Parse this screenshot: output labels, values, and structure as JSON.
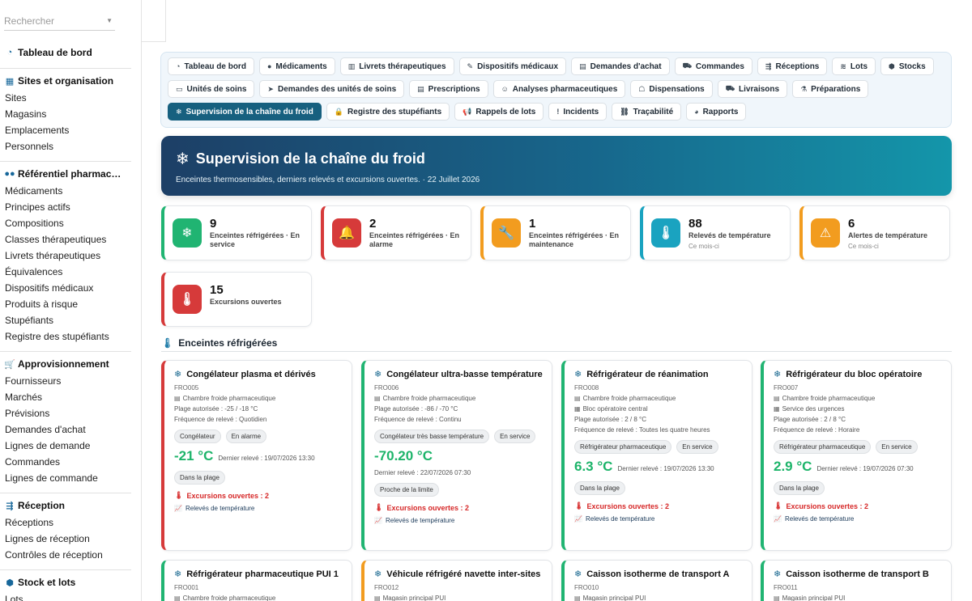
{
  "search": {
    "placeholder": "Rechercher"
  },
  "sidebar": {
    "dashboard": "Tableau de bord",
    "sections": [
      {
        "title": "Sites et organisation",
        "icon": "building-icon",
        "glyph": "▦",
        "items": [
          "Sites",
          "Magasins",
          "Emplacements",
          "Personnels"
        ]
      },
      {
        "title": "Référentiel pharmac…",
        "icon": "pills-icon",
        "glyph": "●●",
        "items": [
          "Médicaments",
          "Principes actifs",
          "Compositions",
          "Classes thérapeutiques",
          "Livrets thérapeutiques",
          "Équivalences",
          "Dispositifs médicaux",
          "Produits à risque",
          "Stupéfiants",
          "Registre des stupéfiants"
        ]
      },
      {
        "title": "Approvisionnement",
        "icon": "cart-icon",
        "glyph": "🛒",
        "items": [
          "Fournisseurs",
          "Marchés",
          "Prévisions",
          "Demandes d'achat",
          "Lignes de demande",
          "Commandes",
          "Lignes de commande"
        ]
      },
      {
        "title": "Réception",
        "icon": "truck-loading-icon",
        "glyph": "⇶",
        "items": [
          "Réceptions",
          "Lignes de réception",
          "Contrôles de réception"
        ]
      },
      {
        "title": "Stock et lots",
        "icon": "cubes-icon",
        "glyph": "⬢",
        "items": [
          "Lots"
        ]
      }
    ]
  },
  "tabs": {
    "row1": [
      {
        "label": "Tableau de bord",
        "icon": "gauge-icon",
        "glyph": "◔"
      },
      {
        "label": "Médicaments",
        "icon": "pills-icon",
        "glyph": "●"
      },
      {
        "label": "Livrets thérapeutiques",
        "icon": "book-icon",
        "glyph": "▥"
      },
      {
        "label": "Dispositifs médicaux",
        "icon": "syringe-icon",
        "glyph": "✎"
      },
      {
        "label": "Demandes d'achat",
        "icon": "file-icon",
        "glyph": "▤"
      },
      {
        "label": "Commandes",
        "icon": "cart-icon",
        "glyph": "⛟"
      },
      {
        "label": "Réceptions",
        "icon": "truck-loading-icon",
        "glyph": "⇶"
      },
      {
        "label": "Lots",
        "icon": "layers-icon",
        "glyph": "≋"
      },
      {
        "label": "Stocks",
        "icon": "cubes-icon",
        "glyph": "⬢"
      }
    ],
    "row2": [
      {
        "label": "Unités de soins",
        "icon": "bed-icon",
        "glyph": "▭"
      },
      {
        "label": "Demandes des unités de soins",
        "icon": "paper-plane-icon",
        "glyph": "➤"
      },
      {
        "label": "Prescriptions",
        "icon": "prescription-icon",
        "glyph": "▤"
      },
      {
        "label": "Analyses pharmaceutiques",
        "icon": "user-doctor-icon",
        "glyph": "☺"
      },
      {
        "label": "Dispensations",
        "icon": "hand-holding-medical-icon",
        "glyph": "☖"
      },
      {
        "label": "Livraisons",
        "icon": "truck-icon",
        "glyph": "⛟"
      },
      {
        "label": "Préparations",
        "icon": "mortar-pestle-icon",
        "glyph": "⚗"
      }
    ],
    "row3": [
      {
        "label": "Supervision de la chaîne du froid",
        "icon": "snowflake-icon",
        "glyph": "❄",
        "active": true
      },
      {
        "label": "Registre des stupéfiants",
        "icon": "lock-icon",
        "glyph": "🔒"
      },
      {
        "label": "Rappels de lots",
        "icon": "bullhorn-icon",
        "glyph": "📢"
      },
      {
        "label": "Incidents",
        "icon": "exclamation-circle-icon",
        "glyph": "!"
      },
      {
        "label": "Traçabilité",
        "icon": "sitemap-icon",
        "glyph": "⛓"
      },
      {
        "label": "Rapports",
        "icon": "chart-pie-icon",
        "glyph": "◕"
      }
    ]
  },
  "hero": {
    "title": "Supervision de la chaîne du froid",
    "subtitle": "Enceintes thermosensibles, derniers relevés et excursions ouvertes. · 22 Juillet 2026"
  },
  "stats": [
    {
      "value": "9",
      "label": "Enceintes réfrigérées · En service",
      "sub": "",
      "color": "#20b472",
      "icon": "snowflake-icon",
      "glyph": "❄"
    },
    {
      "value": "2",
      "label": "Enceintes réfrigérées · En alarme",
      "sub": "",
      "color": "#d63a3a",
      "icon": "bell-icon",
      "glyph": "🔔"
    },
    {
      "value": "1",
      "label": "Enceintes réfrigérées · En maintenance",
      "sub": "",
      "color": "#f29c1f",
      "icon": "wrench-icon",
      "glyph": "🔧"
    },
    {
      "value": "88",
      "label": "Relevés de température",
      "sub": "Ce mois-ci",
      "color": "#1aa3c0",
      "icon": "thermometer-icon",
      "glyph": "🌡"
    },
    {
      "value": "6",
      "label": "Alertes de température",
      "sub": "Ce mois-ci",
      "color": "#f29c1f",
      "icon": "warning-icon",
      "glyph": "⚠"
    },
    {
      "value": "15",
      "label": "Excursions ouvertes",
      "sub": "",
      "color": "#d63a3a",
      "icon": "thermometer-hot-icon",
      "glyph": "🌡"
    }
  ],
  "section_heading": "Enceintes réfrigérées",
  "cards": [
    {
      "title": "Congélateur plasma et dérivés",
      "code": "FRO005",
      "location": "Chambre froide pharmaceutique",
      "service": "",
      "range": "Plage autorisée : -25 / -18 °C",
      "frequency": "Fréquence de relevé : Quotidien",
      "pills": [
        "Congélateur",
        "En alarme"
      ],
      "temp": "-21 °C",
      "last": "Dernier relevé : 19/07/2026 13:30",
      "status": "Dans la plage",
      "excursions": "Excursions ouvertes : 2",
      "readings": "Relevés de température",
      "accent": "#d63a3a",
      "temp_color": "#1db46a"
    },
    {
      "title": "Congélateur ultra-basse température",
      "code": "FRO006",
      "location": "Chambre froide pharmaceutique",
      "service": "",
      "range": "Plage autorisée : -86 / -70 °C",
      "frequency": "Fréquence de relevé : Continu",
      "pills": [
        "Congélateur très basse température",
        "En service"
      ],
      "temp": "-70.20 °C",
      "last": "Dernier relevé : 22/07/2026 07:30",
      "status": "Proche de la limite",
      "excursions": "Excursions ouvertes : 2",
      "readings": "Relevés de température",
      "accent": "#20b472",
      "temp_color": "#1db46a"
    },
    {
      "title": "Réfrigérateur de réanimation",
      "code": "FRO008",
      "location": "Chambre froide pharmaceutique",
      "service": "Bloc opératoire central",
      "range": "Plage autorisée : 2 / 8 °C",
      "frequency": "Fréquence de relevé : Toutes les quatre heures",
      "pills": [
        "Réfrigérateur pharmaceutique",
        "En service"
      ],
      "temp": "6.3 °C",
      "last": "Dernier relevé : 19/07/2026 13:30",
      "status": "Dans la plage",
      "excursions": "Excursions ouvertes : 2",
      "readings": "Relevés de température",
      "accent": "#20b472",
      "temp_color": "#1db46a"
    },
    {
      "title": "Réfrigérateur du bloc opératoire",
      "code": "FRO007",
      "location": "Chambre froide pharmaceutique",
      "service": "Service des urgences",
      "range": "Plage autorisée : 2 / 8 °C",
      "frequency": "Fréquence de relevé : Horaire",
      "pills": [
        "Réfrigérateur pharmaceutique",
        "En service"
      ],
      "temp": "2.9 °C",
      "last": "Dernier relevé : 19/07/2026 07:30",
      "status": "Dans la plage",
      "excursions": "Excursions ouvertes : 2",
      "readings": "Relevés de température",
      "accent": "#20b472",
      "temp_color": "#1db46a"
    },
    {
      "title": "Réfrigérateur pharmaceutique PUI 1",
      "code": "FRO001",
      "location": "Chambre froide pharmaceutique",
      "accent": "#20b472"
    },
    {
      "title": "Véhicule réfrigéré navette inter-sites",
      "code": "FRO012",
      "location": "Magasin principal PUI",
      "accent": "#f29c1f"
    },
    {
      "title": "Caisson isotherme de transport A",
      "code": "FRO010",
      "location": "Magasin principal PUI",
      "accent": "#20b472"
    },
    {
      "title": "Caisson isotherme de transport B",
      "code": "FRO011",
      "location": "Magasin principal PUI",
      "accent": "#20b472"
    }
  ]
}
